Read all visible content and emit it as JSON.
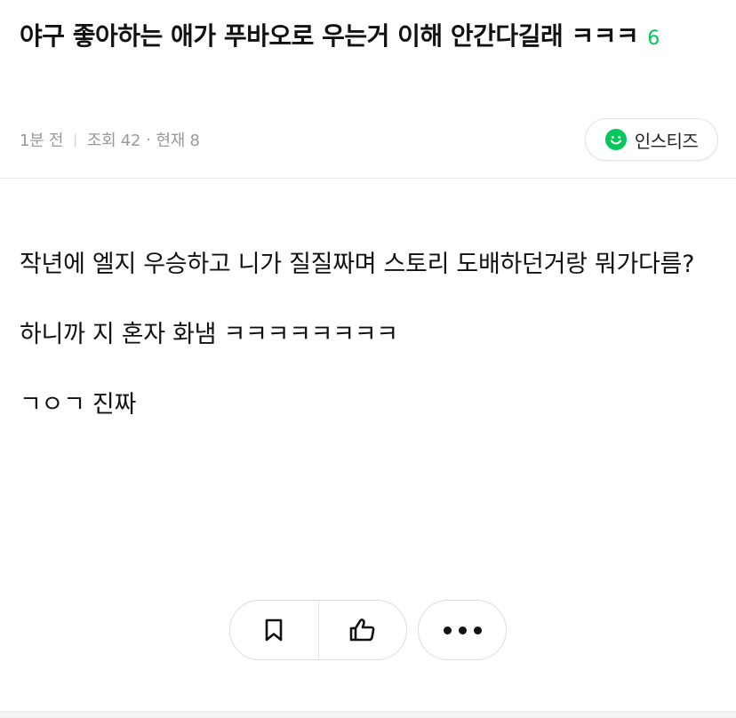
{
  "post": {
    "title": "야구 좋아하는 애가 푸바오로 우는거 이해 안간다길래 ㅋㅋㅋ",
    "comment_count": "6",
    "time": "1분 전",
    "views": "조회 42",
    "current": "현재 8",
    "board": "인스티즈"
  },
  "body": {
    "paragraphs": [
      "작년에 엘지 우승하고 니가 질질짜며 스토리 도배하던거랑 뭐가다름?",
      "하니까 지 혼자 화냄 ㅋㅋㅋㅋㅋㅋㅋㅋ",
      "ㄱㅇㄱ 진짜"
    ]
  },
  "icons": {
    "board": "smile-icon",
    "bookmark": "bookmark-icon",
    "like": "thumbs-up-icon",
    "more": "more-icon"
  },
  "colors": {
    "accent": "#03c75a",
    "meta": "#9a9a9a"
  }
}
